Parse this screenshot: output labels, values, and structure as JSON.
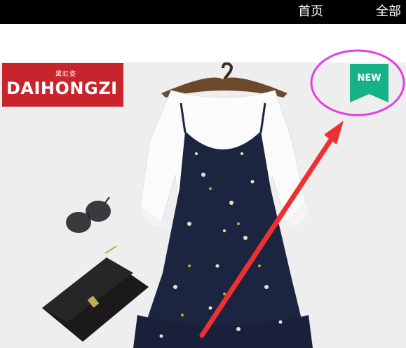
{
  "nav": {
    "home_label": "首页",
    "all_label": "全部"
  },
  "brand": {
    "name": "DAIHONGZI",
    "chinese": "黛虹姿",
    "color": "#c8242b"
  },
  "badge": {
    "label": "NEW",
    "color": "#17b186"
  },
  "annotation": {
    "circle_color": "#e63ce6",
    "arrow_color": "#f03030"
  },
  "photo": {
    "icon": "product-photo"
  }
}
